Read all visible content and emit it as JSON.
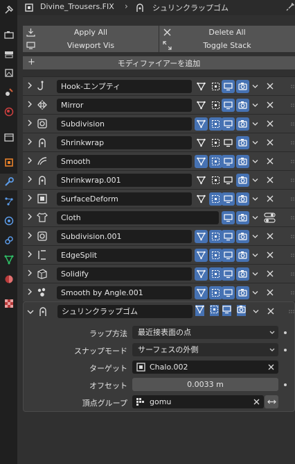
{
  "header": {
    "object_name": "Divine_Trousers.FIX",
    "modifier_name": "シュリンクラップゴム"
  },
  "toolbar": {
    "apply_all": "Apply All",
    "delete_all": "Delete All",
    "viewport_vis": "Viewport Vis",
    "toggle_stack": "Toggle Stack"
  },
  "add_modifier": "モディファイアーを追加",
  "modifiers": [
    {
      "name": "Hook-エンプティ",
      "icon": "hook-icon"
    },
    {
      "name": "Mirror",
      "icon": "mirror-icon"
    },
    {
      "name": "Subdivision",
      "icon": "subdivision-icon"
    },
    {
      "name": "Shrinkwrap",
      "icon": "shrinkwrap-icon"
    },
    {
      "name": "Smooth",
      "icon": "smooth-icon"
    },
    {
      "name": "Shrinkwrap.001",
      "icon": "shrinkwrap-icon"
    },
    {
      "name": "SurfaceDeform",
      "icon": "surface-deform-icon"
    },
    {
      "name": "Cloth",
      "icon": "cloth-icon"
    },
    {
      "name": "Subdivision.001",
      "icon": "subdivision-icon"
    },
    {
      "name": "EdgeSplit",
      "icon": "edge-split-icon"
    },
    {
      "name": "Solidify",
      "icon": "solidify-icon"
    },
    {
      "name": "Smooth by Angle.001",
      "icon": "smooth-by-angle-icon"
    }
  ],
  "expanded": {
    "name": "シュリンクラップゴム",
    "wrap_method_label": "ラップ方法",
    "wrap_method_value": "最近接表面の点",
    "snap_mode_label": "スナップモード",
    "snap_mode_value": "サーフェスの外側",
    "target_label": "ターゲット",
    "target_value": "Chalo.002",
    "offset_label": "オフセット",
    "offset_value": "0.0033 m",
    "vgroup_label": "頂点グループ",
    "vgroup_value": "gomu"
  }
}
